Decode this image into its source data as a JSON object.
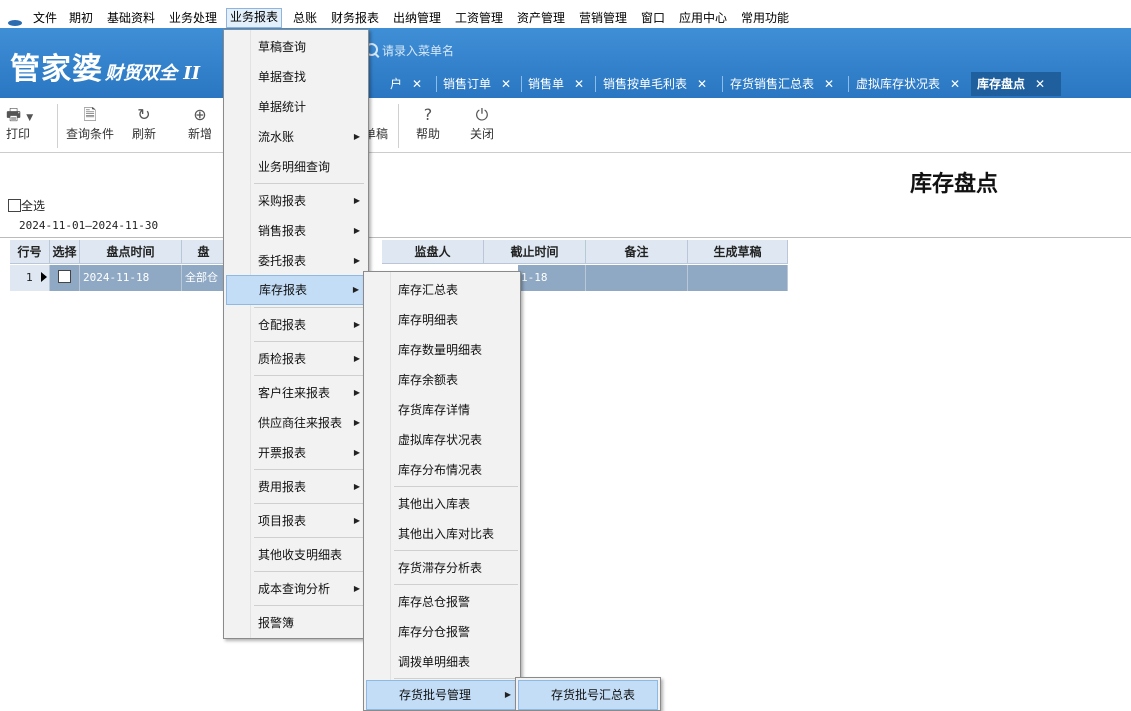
{
  "menubar": {
    "items": [
      "文件",
      "期初",
      "基础资料",
      "业务处理",
      "业务报表",
      "总账",
      "财务报表",
      "出纳管理",
      "工资管理",
      "资产管理",
      "营销管理",
      "窗口",
      "应用中心",
      "常用功能"
    ],
    "active": "业务报表"
  },
  "brand": {
    "name": "管家婆",
    "edition": "财贸双全",
    "suffix": "II"
  },
  "search": {
    "placeholder": "请录入菜单名"
  },
  "tabs": [
    {
      "label": "户"
    },
    {
      "label": "销售订单"
    },
    {
      "label": "销售单"
    },
    {
      "label": "销售按单毛利表"
    },
    {
      "label": "存货销售汇总表"
    },
    {
      "label": "虚拟库存状况表"
    },
    {
      "label": "库存盘点",
      "active": true
    }
  ],
  "toolbar": {
    "print": "打印",
    "query": "查询条件",
    "refresh": "刷新",
    "add": "新增",
    "draft_partial": "单稿",
    "help": "帮助",
    "close": "关闭"
  },
  "page": {
    "title": "库存盘点",
    "select_all": "全选",
    "date_range": "2024-11-01—2024-11-30"
  },
  "grid": {
    "columns": [
      "行号",
      "选择",
      "盘点时间",
      "盘",
      "监盘人",
      "截止时间",
      "备注",
      "生成草稿"
    ],
    "rows": [
      {
        "row_no": "1",
        "time": "2024-11-18",
        "warehouse": "全部仓",
        "cutoff": "1-18",
        "note": "",
        "draft": ""
      }
    ]
  },
  "menu_business_reports": {
    "items": [
      "草稿查询",
      "单据查找",
      "单据统计",
      "流水账",
      "业务明细查询",
      "采购报表",
      "销售报表",
      "委托报表",
      "库存报表",
      "仓配报表",
      "质检报表",
      "客户往来报表",
      "供应商往来报表",
      "开票报表",
      "费用报表",
      "项目报表",
      "其他收支明细表",
      "成本查询分析",
      "报警簿"
    ],
    "highlighted": "库存报表"
  },
  "menu_inventory_reports": {
    "items": [
      "库存汇总表",
      "库存明细表",
      "库存数量明细表",
      "库存余额表",
      "存货库存详情",
      "虚拟库存状况表",
      "库存分布情况表",
      "其他出入库表",
      "其他出入库对比表",
      "存货滞存分析表",
      "库存总仓报警",
      "库存分仓报警",
      "调拨单明细表",
      "存货批号管理"
    ],
    "highlighted": "存货批号管理"
  },
  "menu_batch": {
    "items": [
      "存货批号汇总表"
    ]
  },
  "icons": [
    "printer-icon",
    "dropdown-arrow-icon",
    "query-icon",
    "refresh-icon",
    "add-icon",
    "help-icon",
    "power-icon",
    "search-icon",
    "submenu-arrow-icon",
    "row-pointer-icon"
  ],
  "colors": {
    "banner": "#3585cf",
    "active_tab": "#1f5f9e",
    "menu_highlight": "#c3ddf6",
    "grid_row": "#8fa9c4"
  }
}
